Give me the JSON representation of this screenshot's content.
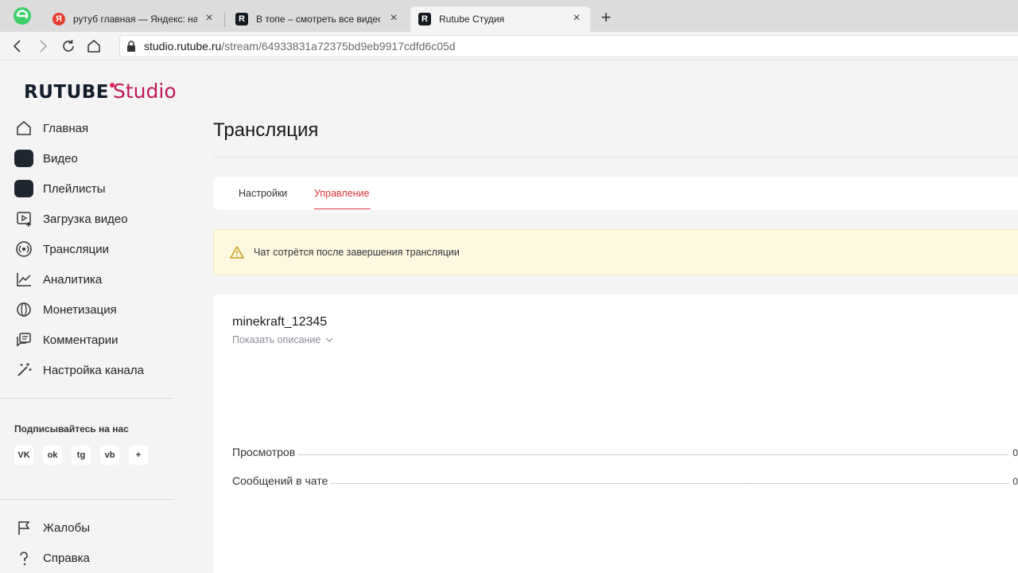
{
  "browser": {
    "tabs": [
      {
        "title": "рутуб главная — Яндекс: на"
      },
      {
        "title": "В топе – смотреть все видео"
      },
      {
        "title": "Rutube Студия"
      }
    ],
    "url_host": "studio.rutube.ru",
    "url_path": "/stream/64933831a72375bd9eb9917cdfd6c05d"
  },
  "logo": {
    "brand": "RUTUBE",
    "product": "Studio"
  },
  "sidebar": {
    "items": [
      {
        "label": "Главная",
        "icon": "home-icon"
      },
      {
        "label": "Видео",
        "icon": "video-square-icon"
      },
      {
        "label": "Плейлисты",
        "icon": "playlist-square-icon"
      },
      {
        "label": "Загрузка видео",
        "icon": "upload-video-icon"
      },
      {
        "label": "Трансляции",
        "icon": "broadcast-icon"
      },
      {
        "label": "Аналитика",
        "icon": "analytics-icon"
      },
      {
        "label": "Монетизация",
        "icon": "monetization-icon"
      },
      {
        "label": "Комментарии",
        "icon": "comments-icon"
      },
      {
        "label": "Настройка канала",
        "icon": "magic-wand-icon"
      }
    ],
    "follow_label": "Подписывайтесь на нас",
    "socials": [
      {
        "name": "vk-icon",
        "glyph": "VK"
      },
      {
        "name": "ok-icon",
        "glyph": "ok"
      },
      {
        "name": "telegram-icon",
        "glyph": "tg"
      },
      {
        "name": "viber-icon",
        "glyph": "vb"
      },
      {
        "name": "sparkle-icon",
        "glyph": "+"
      }
    ],
    "bottom_items": [
      {
        "label": "Жалобы",
        "icon": "flag-icon"
      },
      {
        "label": "Справка",
        "icon": "help-icon"
      }
    ]
  },
  "main": {
    "title": "Трансляция",
    "tabs": [
      {
        "label": "Настройки",
        "active": false
      },
      {
        "label": "Управление",
        "active": true
      }
    ],
    "alert_text": "Чат сотрётся после завершения трансляции",
    "stream_name": "minekraft_12345",
    "show_description": "Показать описание",
    "stats": [
      {
        "label": "Просмотров",
        "value": "0"
      },
      {
        "label": "Сообщений в чате",
        "value": "0"
      }
    ]
  },
  "colors": {
    "accent": "#d9363e",
    "brand_studio": "#c2185b",
    "alert_bg": "#fdf8e0"
  }
}
